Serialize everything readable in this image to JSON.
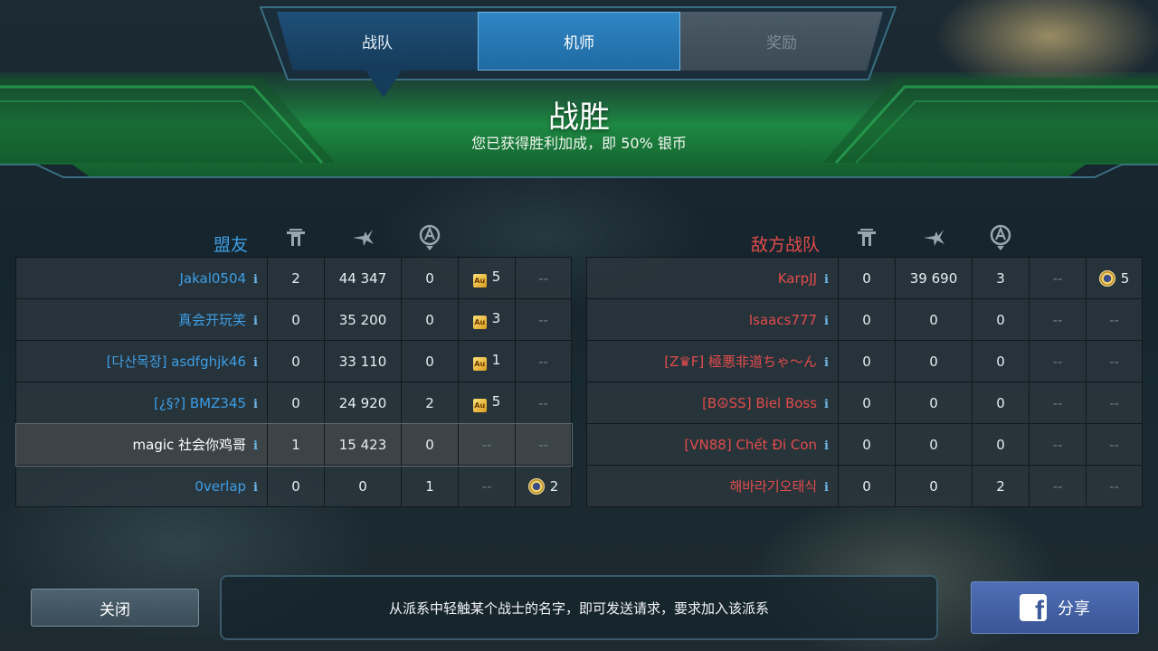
{
  "tabs": [
    {
      "label": "战队",
      "state": "default"
    },
    {
      "label": "机师",
      "state": "active"
    },
    {
      "label": "奖励",
      "state": "disabled"
    }
  ],
  "result": {
    "title": "战胜",
    "subtitle": "您已获得胜利加成，即 50% 银币"
  },
  "allies": {
    "title": "盟友",
    "color": "#3d9ee6",
    "header_icons": [
      "kills-icon",
      "damage-icon",
      "beacon-icon"
    ],
    "rows": [
      {
        "name": "Jakal0504",
        "kills": "2",
        "damage": "44 347",
        "beacons": "0",
        "award": {
          "type": "au",
          "icon": "au-icon",
          "label": "Au",
          "count": "5"
        },
        "extra": "--"
      },
      {
        "name": "真会开玩笑",
        "kills": "0",
        "damage": "35 200",
        "beacons": "0",
        "award": {
          "type": "au",
          "icon": "au-icon",
          "label": "Au",
          "count": "3"
        },
        "extra": "--"
      },
      {
        "name": "[다산목장] asdfghjk46",
        "kills": "0",
        "damage": "33 110",
        "beacons": "0",
        "award": {
          "type": "au",
          "icon": "au-icon",
          "label": "Au",
          "count": "1"
        },
        "extra": "--"
      },
      {
        "name": "[¿§?] BMZ345",
        "kills": "0",
        "damage": "24 920",
        "beacons": "2",
        "award": {
          "type": "au",
          "icon": "au-icon",
          "label": "Au",
          "count": "5"
        },
        "extra": "--"
      },
      {
        "name": "magic 社会你鸡哥",
        "kills": "1",
        "damage": "15 423",
        "beacons": "0",
        "award": null,
        "award_text": "--",
        "extra": "--",
        "self": true
      },
      {
        "name": "0verlap",
        "kills": "0",
        "damage": "0",
        "beacons": "1",
        "award": null,
        "award_text": "--",
        "extra": {
          "type": "medal",
          "icon": "medal-icon",
          "count": "2"
        }
      }
    ]
  },
  "enemies": {
    "title": "敌方战队",
    "color": "#e24c4c",
    "header_icons": [
      "kills-icon",
      "damage-icon",
      "beacon-icon"
    ],
    "rows": [
      {
        "name": "KarpJJ",
        "kills": "0",
        "damage": "39 690",
        "beacons": "3",
        "award_text": "--",
        "extra": {
          "type": "medal",
          "icon": "medal-icon",
          "count": "5"
        }
      },
      {
        "name": "Isaacs777",
        "kills": "0",
        "damage": "0",
        "beacons": "0",
        "award_text": "--",
        "extra": "--"
      },
      {
        "name": "[Z♛F] 極悪非道ちゃ～ん",
        "kills": "0",
        "damage": "0",
        "beacons": "0",
        "award_text": "--",
        "extra": "--"
      },
      {
        "name": "[B☮SS] Biel Boss",
        "kills": "0",
        "damage": "0",
        "beacons": "0",
        "award_text": "--",
        "extra": "--"
      },
      {
        "name": "[VN88] Chết Đi Con",
        "kills": "0",
        "damage": "0",
        "beacons": "0",
        "award_text": "--",
        "extra": "--"
      },
      {
        "name": "해바라기오태식",
        "kills": "0",
        "damage": "0",
        "beacons": "2",
        "award_text": "--",
        "extra": "--"
      }
    ]
  },
  "info_icon_glyph": "i",
  "footer": {
    "close_label": "关闭",
    "hint": "从派系中轻触某个战士的名字，即可发送请求，要求加入该派系",
    "share_label": "分享",
    "share_icon": "facebook-icon",
    "share_icon_glyph": "f"
  }
}
